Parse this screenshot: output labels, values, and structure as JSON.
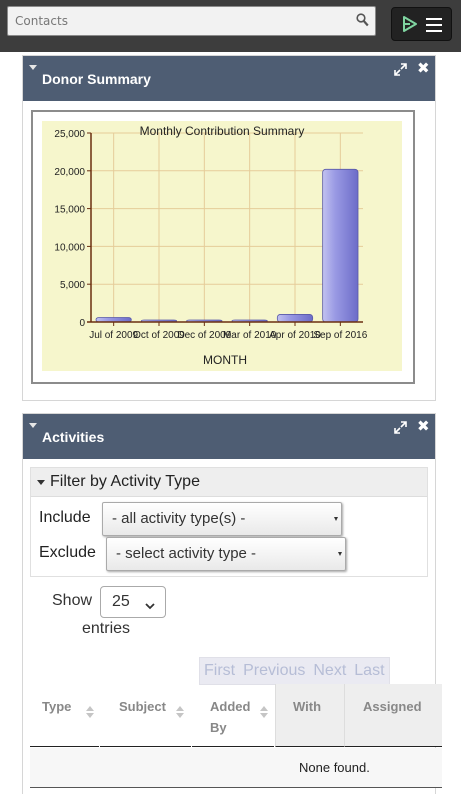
{
  "search": {
    "placeholder": "Contacts"
  },
  "donor_summary": {
    "title": "Donor Summary"
  },
  "chart_data": {
    "type": "bar",
    "title": "Monthly Contribution Summary",
    "xlabel": "MONTH",
    "ylabel": "",
    "categories": [
      "Jul of 2009",
      "Oct of 2009",
      "Dec of 2009",
      "Mar of 2010",
      "Apr of 2010",
      "Sep of 2016"
    ],
    "values": [
      600,
      150,
      200,
      50,
      1000,
      20200
    ],
    "ylim": [
      0,
      25000
    ],
    "yticks": [
      "0",
      "5,000",
      "10,000",
      "15,000",
      "20,000",
      "25,000"
    ],
    "ytick_values": [
      0,
      5000,
      10000,
      15000,
      20000,
      25000
    ],
    "grid": true,
    "colors": {
      "bar": "#8585d8",
      "plot_bg": "#f6f6cc",
      "grid": "#e5cc99",
      "axis": "#6a2f10"
    }
  },
  "activities": {
    "title": "Activities",
    "filter_title": "Filter by Activity Type",
    "include_label": "Include",
    "include_value": "- all activity type(s) -",
    "exclude_label": "Exclude",
    "exclude_value": "- select activity type -",
    "show_label": "Show",
    "page_size": "25",
    "entries_label": "entries",
    "pager": {
      "first": "First",
      "previous": "Previous",
      "next": "Next",
      "last": "Last"
    },
    "columns": {
      "type": "Type",
      "subject": "Subject",
      "added_by_1": "Added",
      "added_by_2": "By",
      "with": "With",
      "assigned": "Assigned"
    },
    "empty_text": "None found."
  }
}
